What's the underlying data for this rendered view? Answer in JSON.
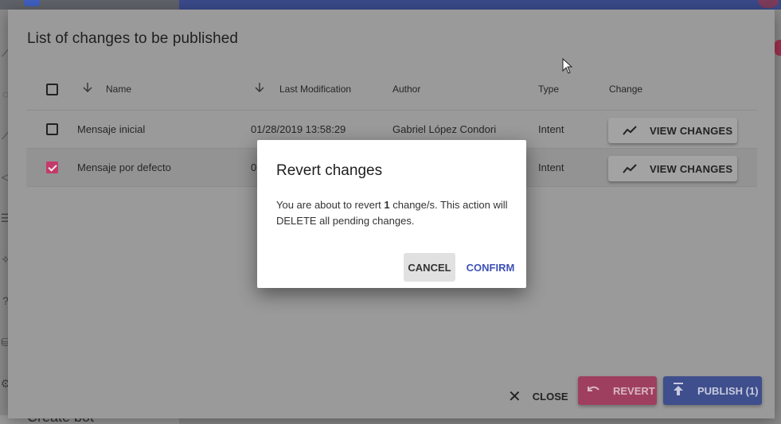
{
  "background": {
    "bottom_text": "Create bot"
  },
  "dialog": {
    "title": "List of changes to be published",
    "columns": {
      "name": "Name",
      "last_modification": "Last Modification",
      "author": "Author",
      "type": "Type",
      "change": "Change"
    },
    "rows": [
      {
        "name": "Mensaje inicial",
        "last_modification": "01/28/2019 13:58:29",
        "author": "Gabriel López Condori",
        "type": "Intent",
        "change_label": "VIEW CHANGES",
        "checked": false
      },
      {
        "name": "Mensaje por defecto",
        "last_modification": "0",
        "author": "",
        "type": "Intent",
        "change_label": "VIEW CHANGES",
        "checked": true
      }
    ],
    "footer": {
      "close_label": "CLOSE",
      "revert_label": "REVERT",
      "publish_label": "PUBLISH (1)"
    }
  },
  "modal": {
    "title": "Revert changes",
    "body_prefix": "You are about to revert ",
    "body_count": "1",
    "body_suffix": " change/s. This action will DELETE all pending changes.",
    "cancel_label": "CANCEL",
    "confirm_label": "CONFIRM"
  },
  "colors": {
    "accent_pink": "#e0427a",
    "primary_blue": "#3f51b5",
    "overlay": "rgba(0,0,0,0.4)"
  },
  "icons": {
    "sort": "arrow-down-icon",
    "view_changes": "trending-icon",
    "close": "close-icon",
    "revert": "undo-icon",
    "publish": "publish-icon"
  }
}
